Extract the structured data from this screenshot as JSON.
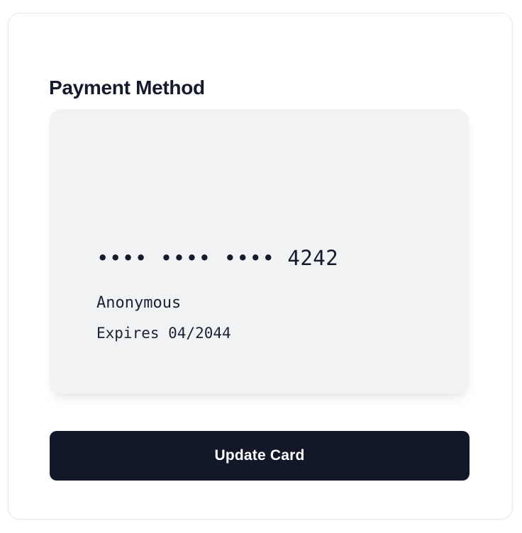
{
  "page": {
    "title": "Payment Method",
    "background_color": "#ffffff",
    "panel_border_color": "#e7e9ec"
  },
  "card": {
    "number_masked": "•••• •••• •••• 4242",
    "last4": "4242",
    "holder_name": "Anonymous",
    "expiry_label": "Expires 04/2044",
    "expiry_month": "04",
    "expiry_year": "2044",
    "surface_color": "#f1f2f4",
    "text_color": "#151b2d"
  },
  "actions": {
    "update_card_label": "Update Card",
    "update_card_bg": "#121828",
    "update_card_text_color": "#ffffff"
  }
}
